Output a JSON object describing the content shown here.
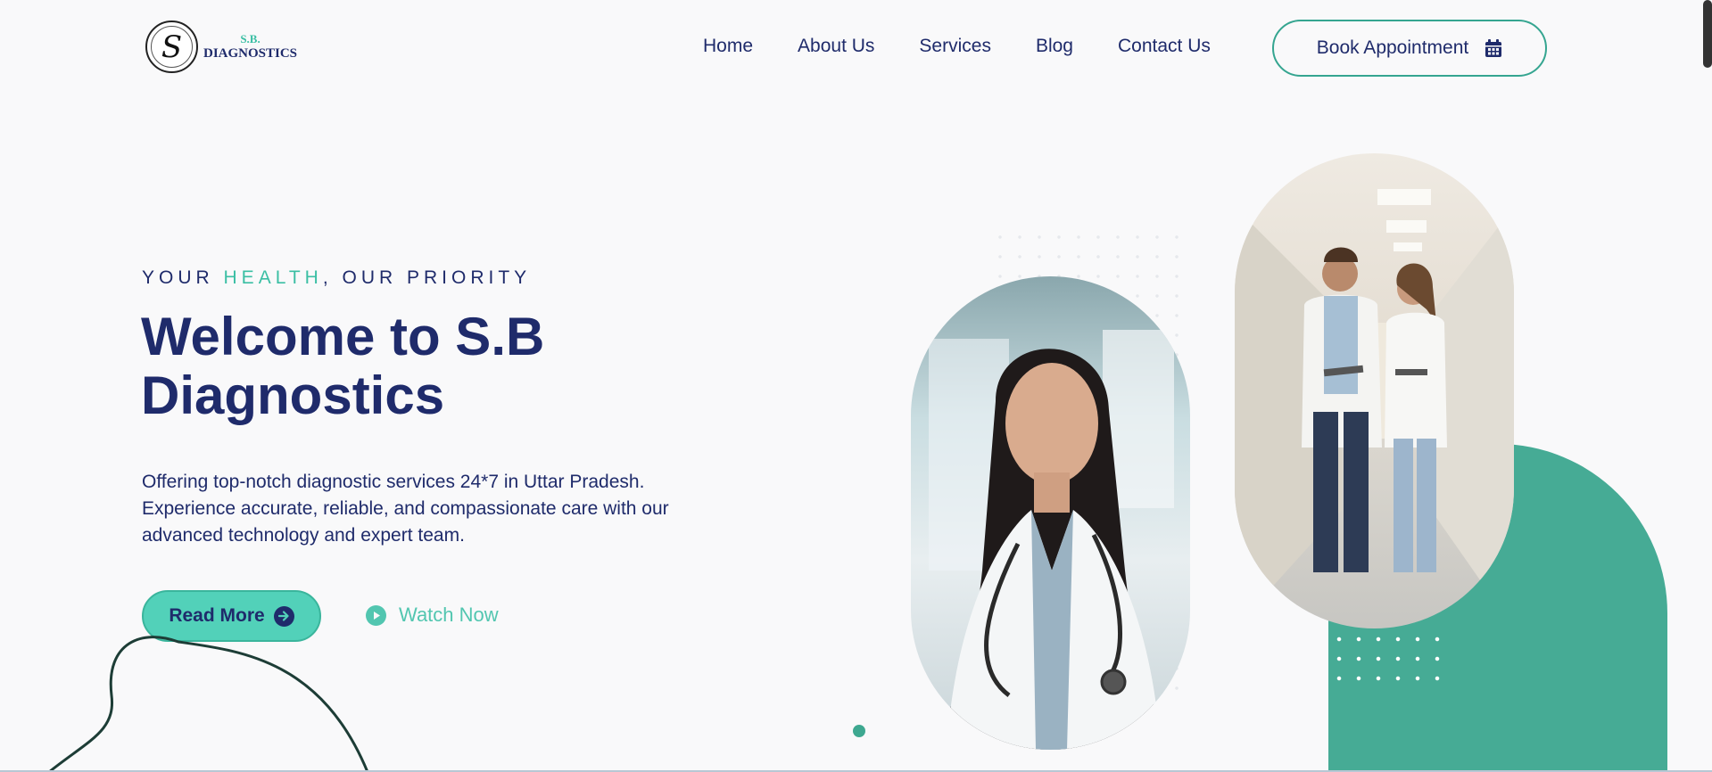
{
  "logo": {
    "glyph": "S",
    "line1": "S.B.",
    "line2": "DIAGNOSTICS",
    "icon": "sb-monogram-logo"
  },
  "nav": {
    "items": [
      "Home",
      "About Us",
      "Services",
      "Blog",
      "Contact Us"
    ]
  },
  "book_button": {
    "label": "Book Appointment",
    "icon": "calendar-icon"
  },
  "hero": {
    "eyebrow_pre": "YOUR ",
    "eyebrow_highlight": "HEALTH",
    "eyebrow_post": ", OUR PRIORITY",
    "title": "Welcome to S.B Diagnostics",
    "description": "Offering top-notch diagnostic services 24*7 in Uttar Pradesh. Experience accurate, reliable, and compassionate care with our advanced technology and expert team.",
    "read_more_label": "Read More",
    "watch_now_label": "Watch Now"
  },
  "colors": {
    "navy": "#1f2b6b",
    "teal": "#46ab95",
    "mint": "#52d1b9",
    "background": "#f9f9fa"
  }
}
